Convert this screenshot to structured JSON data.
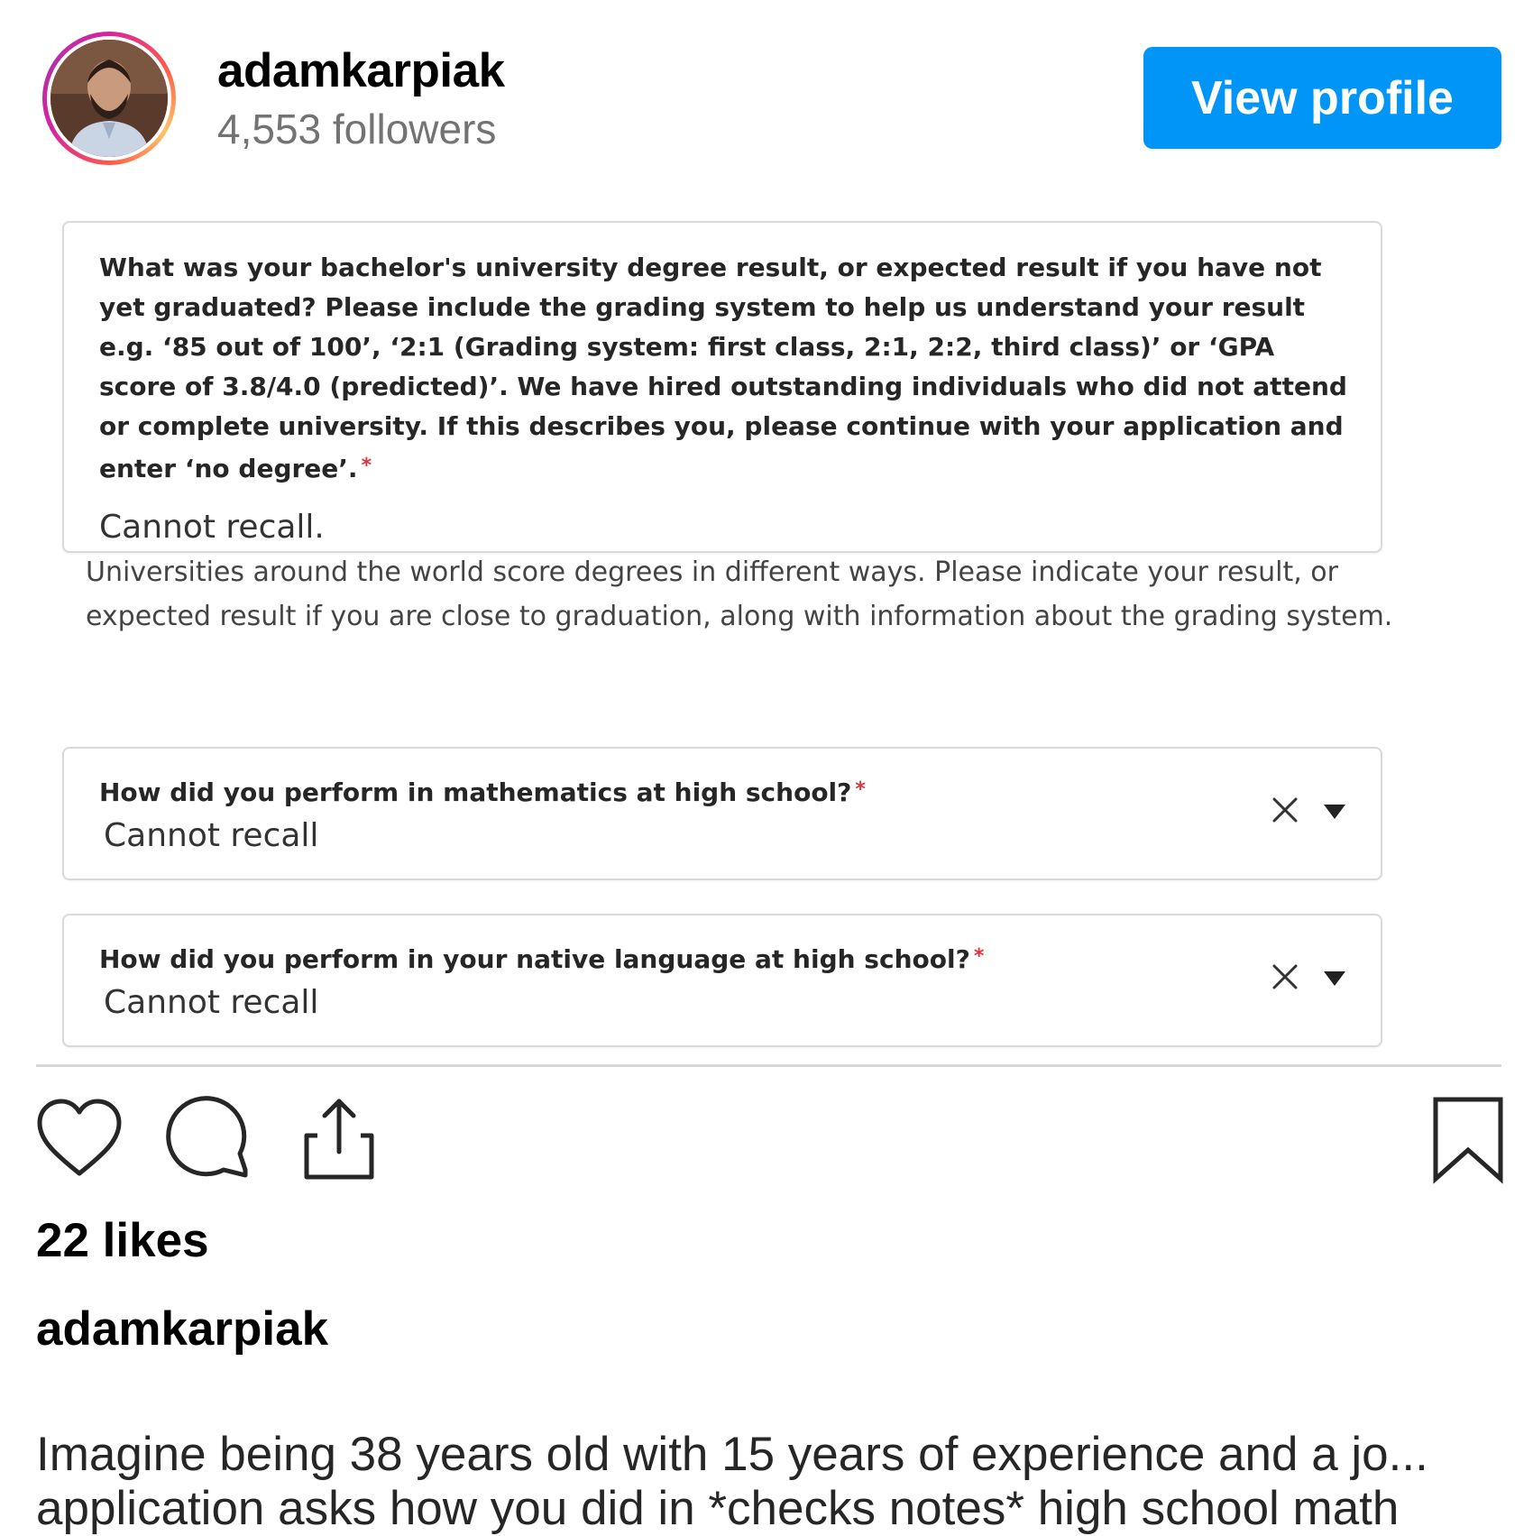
{
  "header": {
    "username": "adamkarpiak",
    "followers": "4,553 followers",
    "view_profile_label": "View profile"
  },
  "form": {
    "degree_question": "What was your bachelor's university degree result, or expected result if you have not yet graduated? Please include the grading system to help us understand your result e.g. ‘85 out of 100’, ‘2:1 (Grading system: first class, 2:1, 2:2, third class)’ or ‘GPA score of 3.8/4.0 (predicted)’. We have hired outstanding individuals who did not attend or complete university. If this describes you, please continue with your application and enter ‘no degree’.",
    "required_mark": "*",
    "degree_answer": "Cannot recall.",
    "degree_helper": "Universities around the world score degrees in different ways. Please indicate your result, or expected result if you are close to graduation, along with information about the grading system.",
    "math_question": "How did you perform in mathematics at high school?",
    "math_answer": "Cannot recall",
    "language_question": "How did you perform in your native language at high school?",
    "language_answer": "Cannot recall"
  },
  "actions": {
    "icons": [
      "heart-icon",
      "comment-icon",
      "share-icon",
      "bookmark-icon"
    ]
  },
  "likes": "22 likes",
  "caption": {
    "username": "adamkarpiak",
    "line1": "Imagine being 38 years old with 15 years of experience and a jo...",
    "line2": "application asks how you did in *checks notes* high school math"
  },
  "colors": {
    "accent": "#0095f6",
    "required": "#e0323c",
    "muted": "#737373"
  }
}
